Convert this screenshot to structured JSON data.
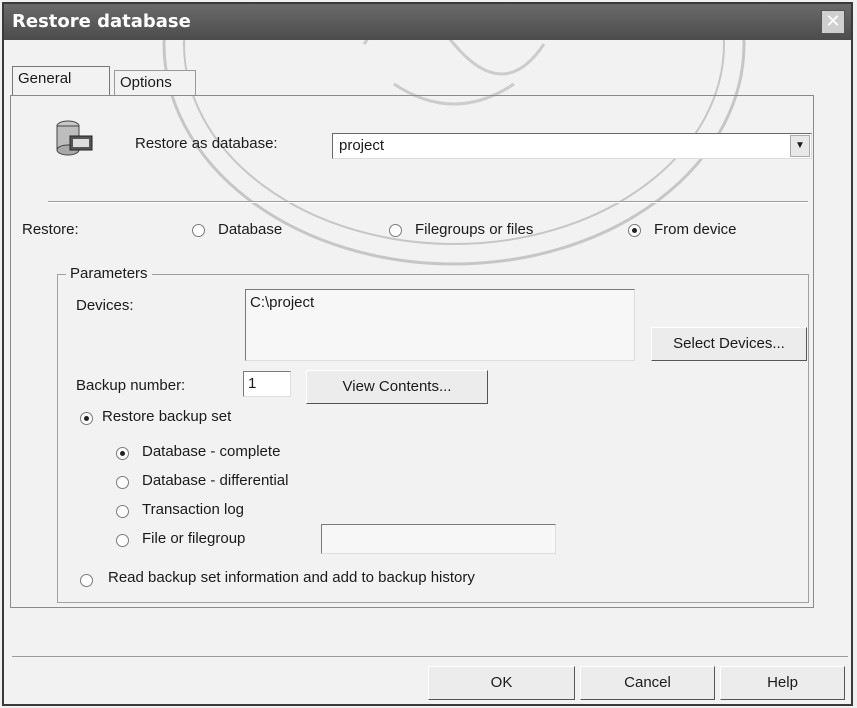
{
  "window": {
    "title": "Restore database"
  },
  "tabs": [
    {
      "label": "General",
      "active": true
    },
    {
      "label": "Options",
      "active": false
    }
  ],
  "restore_as": {
    "label": "Restore as database:",
    "value": "project"
  },
  "restore": {
    "label": "Restore:",
    "options": [
      {
        "label": "Database",
        "selected": false
      },
      {
        "label": "Filegroups or files",
        "selected": false
      },
      {
        "label": "From device",
        "selected": true
      }
    ]
  },
  "parameters": {
    "title": "Parameters",
    "devices_label": "Devices:",
    "devices_value": "C:\\project",
    "select_devices_label": "Select Devices...",
    "backup_number_label": "Backup number:",
    "backup_number_value": "1",
    "view_contents_label": "View Contents...",
    "restore_backup_set": {
      "label": "Restore backup set",
      "selected": true
    },
    "backup_types": [
      {
        "label": "Database - complete",
        "selected": true
      },
      {
        "label": "Database - differential",
        "selected": false
      },
      {
        "label": "Transaction log",
        "selected": false
      },
      {
        "label": "File or filegroup",
        "selected": false
      }
    ],
    "file_or_filegroup_value": "",
    "read_backup_set": {
      "label": "Read backup set information and add to backup history",
      "selected": false
    }
  },
  "buttons": {
    "ok": "OK",
    "cancel": "Cancel",
    "help": "Help"
  },
  "icons": {
    "close": "close-icon",
    "database": "database-icon",
    "dropdown": "chevron-down-icon"
  }
}
